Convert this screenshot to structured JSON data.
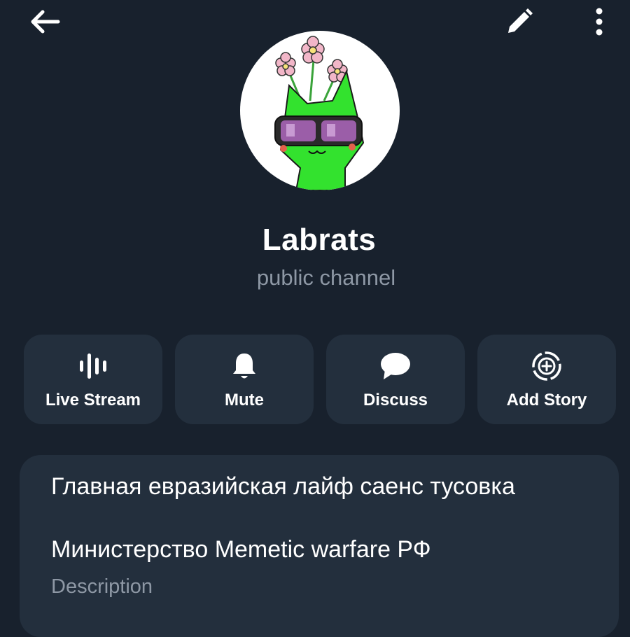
{
  "header": {
    "back_icon": "arrow-left-icon",
    "edit_icon": "pencil-icon",
    "more_icon": "more-vertical-icon"
  },
  "channel": {
    "name": "Labrats",
    "subtitle": "public channel"
  },
  "actions": [
    {
      "label": "Live Stream",
      "icon": "live-stream-icon"
    },
    {
      "label": "Mute",
      "icon": "bell-icon"
    },
    {
      "label": "Discuss",
      "icon": "chat-bubble-icon"
    },
    {
      "label": "Add Story",
      "icon": "add-story-icon"
    }
  ],
  "info": {
    "line1": "Главная евразийская лайф саенс тусовка",
    "line2": "Министерство Memetic warfare РФ",
    "description_label": "Description"
  },
  "colors": {
    "background": "#18212d",
    "card": "#232f3d",
    "text_primary": "#ffffff",
    "text_secondary": "#8e98a5"
  }
}
